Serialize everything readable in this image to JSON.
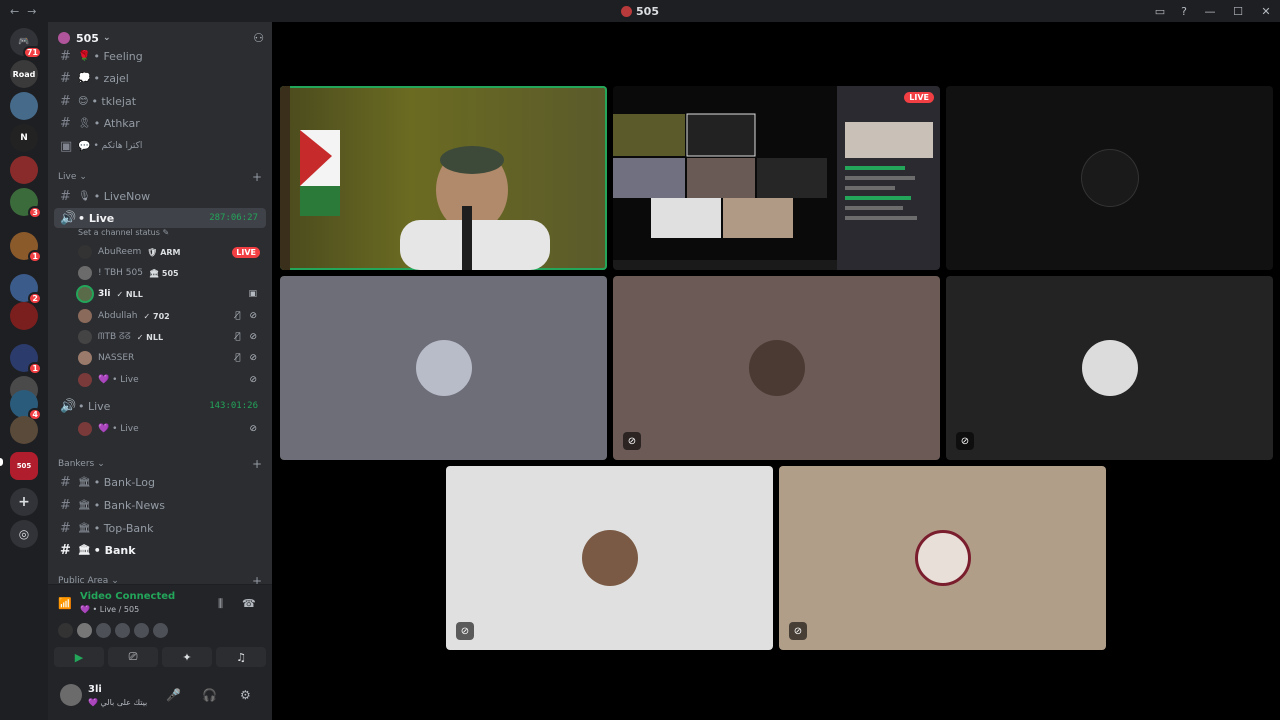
{
  "window": {
    "title": "505",
    "nav_back": "←",
    "nav_fwd": "→"
  },
  "server": {
    "name": "505",
    "chev": "⌄",
    "invite_icon": "person-add-icon"
  },
  "channels_top": [
    {
      "emoji": "🌹",
      "label": "• Feeling"
    },
    {
      "emoji": "💭",
      "label": "• zajel"
    },
    {
      "emoji": "😊",
      "label": "• tklejat"
    },
    {
      "emoji": "🎗",
      "label": "• Athkar"
    },
    {
      "emoji": "💬",
      "label": "• اكترا هاتكم"
    }
  ],
  "cat_live": {
    "label": "Live",
    "chev": "⌄",
    "plus": "+"
  },
  "channel_livenow": {
    "emoji": "🎙",
    "label": "• LiveNow"
  },
  "channel_live1": {
    "label": "• Live",
    "timer": "287:06:27",
    "status": "Set a channel status ✎"
  },
  "voice_users": [
    {
      "name": "AbuReem",
      "tag": "🛡 ARM",
      "live": "LIVE",
      "icons": ""
    },
    {
      "name": "! TBH 505",
      "tag": "🏛 505",
      "live": "",
      "icons": ""
    },
    {
      "name": "3li",
      "tag": "✓ NLL",
      "live": "",
      "icons": "▣"
    },
    {
      "name": "Abdullah",
      "tag": "✓ 702",
      "live": "",
      "icons": "🎙̸ ⊘"
    },
    {
      "name": "ᗰTB ᘔᘔ",
      "tag": "✓ NLL",
      "live": "",
      "icons": "🎙̸ ⊘"
    },
    {
      "name": "NASSER",
      "tag": "",
      "live": "",
      "icons": "🎙̸ ⊘"
    },
    {
      "name": "💜 • Live",
      "tag": "",
      "live": "",
      "icons": "⊘"
    }
  ],
  "channel_live2": {
    "label": "• Live",
    "timer": "143:01:26"
  },
  "voice_users2": [
    {
      "name": "💜 • Live",
      "icons": "⊘"
    }
  ],
  "cat_bankers": {
    "label": "Bankers",
    "chev": "⌄",
    "plus": "+"
  },
  "channels_bank": [
    {
      "emoji": "🏛",
      "label": "• Bank-Log"
    },
    {
      "emoji": "🏛",
      "label": "• Bank-News"
    },
    {
      "emoji": "🏛",
      "label": "• Top-Bank"
    },
    {
      "emoji": "🏛",
      "label": "• Bank"
    }
  ],
  "cat_public": {
    "label": "Public Area",
    "chev": "⌄",
    "plus": "+"
  },
  "voice_panel": {
    "title": "Video Connected",
    "sub": "💜 • Live / 505"
  },
  "user_panel": {
    "name": "3li",
    "status": "💜 بيتك على بالي"
  },
  "rail": [
    {
      "label": "🎮",
      "badge": "71",
      "color": "#313338"
    },
    {
      "label": "Road",
      "badge": "",
      "color": "#3a3a3a"
    },
    {
      "label": "",
      "badge": "",
      "color": "#456a8a"
    },
    {
      "label": "N",
      "badge": "",
      "color": "#222"
    },
    {
      "label": "",
      "badge": "",
      "color": "#8a2b2b"
    },
    {
      "label": "",
      "badge": "3",
      "color": "#3b6b3b"
    },
    {
      "label": "",
      "badge": "1",
      "color": "#8a5a2b"
    },
    {
      "label": "",
      "badge": "2",
      "color": "#3b5b8a"
    },
    {
      "label": "",
      "badge": "",
      "color": "#7a1e1e"
    },
    {
      "label": "",
      "badge": "1",
      "color": "#2b3b6b"
    },
    {
      "label": "",
      "badge": "",
      "color": "#4a4a4a"
    },
    {
      "label": "",
      "badge": "4",
      "color": "#2b5b7b"
    },
    {
      "label": "",
      "badge": "",
      "color": "#5a4a3a"
    },
    {
      "label": "505",
      "badge": "",
      "color": "#b01e2e"
    }
  ],
  "tiles": [
    {
      "name": "tile-camera",
      "live": ""
    },
    {
      "name": "tile-screenshare",
      "live": "LIVE"
    }
  ],
  "colors": {
    "speaking": "#23a55a",
    "live": "#f23f43",
    "accent": "#5865f2"
  }
}
